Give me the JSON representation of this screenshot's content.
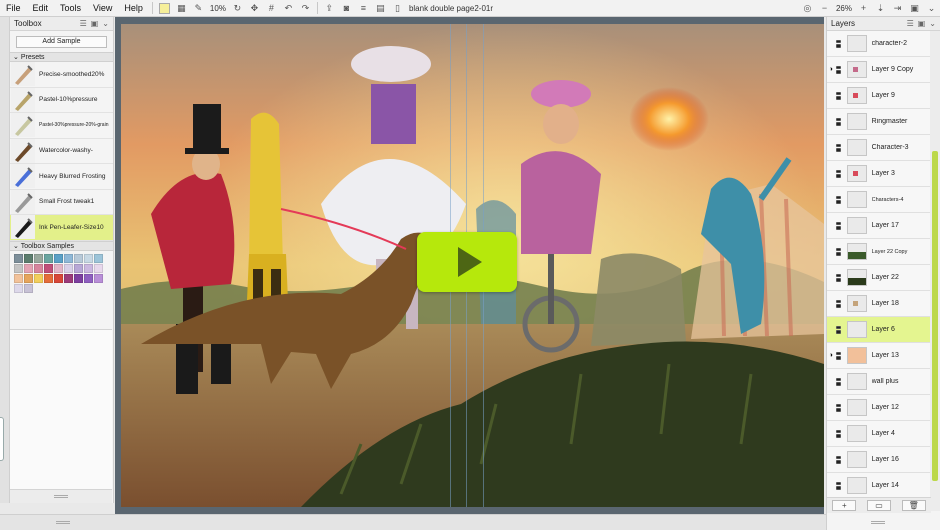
{
  "menu": {
    "items": [
      "File",
      "Edit",
      "Tools",
      "View",
      "Help"
    ],
    "zoom": "10%",
    "document_title": "blank double page2-01r",
    "right_zoom": "26%"
  },
  "toolbox": {
    "title": "Toolbox",
    "add_sample_label": "Add Sample",
    "presets_label": "Presets",
    "presets": [
      {
        "label": "Precise-smoothed20%"
      },
      {
        "label": "Pastel-10%pressure"
      },
      {
        "label": "Pastel-30%pressure-20%-grain"
      },
      {
        "label": "Watercolor-washy-"
      },
      {
        "label": "Heavy Blurred Frosting"
      },
      {
        "label": "Small Frost tweak1"
      },
      {
        "label": "Ink Pen-Leafer-Size10"
      }
    ],
    "samples_label": "Toolbox Samples",
    "sample_colors": [
      "#7d8f9a",
      "#5c7d6e",
      "#98a89d",
      "#6aa5a0",
      "#5aa0c6",
      "#8fb8d7",
      "#b7c9d8",
      "#c7d8e4",
      "#9cc4d9",
      "#c4c4c4",
      "#e3a3b4",
      "#d7859e",
      "#c04f7a",
      "#e2b5c8",
      "#d8d0e8",
      "#b8a8d6",
      "#cbb8e0",
      "#e7d8ec",
      "#f2c29a",
      "#e6a55c",
      "#f2cf5c",
      "#e56d3a",
      "#d84738",
      "#9c3b7a",
      "#7d3fa0",
      "#8f5fc0",
      "#b98fd8",
      "#ddd8ea",
      "#c8c2d6"
    ]
  },
  "layers": {
    "title": "Layers",
    "items": [
      {
        "name": "character-2",
        "selected": false,
        "visible": false,
        "small": false
      },
      {
        "name": "Layer 9 Copy",
        "selected": false,
        "visible": true,
        "small": false
      },
      {
        "name": "Layer 9",
        "selected": false,
        "visible": false,
        "small": false
      },
      {
        "name": "Ringmaster",
        "selected": false,
        "visible": false,
        "small": false
      },
      {
        "name": "Character-3",
        "selected": false,
        "visible": false,
        "small": false
      },
      {
        "name": "Layer 3",
        "selected": false,
        "visible": false,
        "small": false
      },
      {
        "name": "Characters-4",
        "selected": false,
        "visible": false,
        "small": true
      },
      {
        "name": "Layer 17",
        "selected": false,
        "visible": false,
        "small": false
      },
      {
        "name": "Layer 22 Copy",
        "selected": false,
        "visible": false,
        "small": true
      },
      {
        "name": "Layer 22",
        "selected": false,
        "visible": false,
        "small": false
      },
      {
        "name": "Layer 18",
        "selected": false,
        "visible": false,
        "small": false
      },
      {
        "name": "Layer 6",
        "selected": true,
        "visible": false,
        "small": false
      },
      {
        "name": "Layer 13",
        "selected": false,
        "visible": true,
        "small": false
      },
      {
        "name": "wall plus",
        "selected": false,
        "visible": false,
        "small": false
      },
      {
        "name": "Layer 12",
        "selected": false,
        "visible": false,
        "small": false
      },
      {
        "name": "Layer 4",
        "selected": false,
        "visible": false,
        "small": false
      },
      {
        "name": "Layer 16",
        "selected": false,
        "visible": false,
        "small": false
      },
      {
        "name": "Layer 14",
        "selected": false,
        "visible": false,
        "small": false
      }
    ],
    "add_label": "+",
    "delete_label": "🗑"
  },
  "colors": {
    "accent": "#b6e80c",
    "selected_row": "#e4f590"
  }
}
